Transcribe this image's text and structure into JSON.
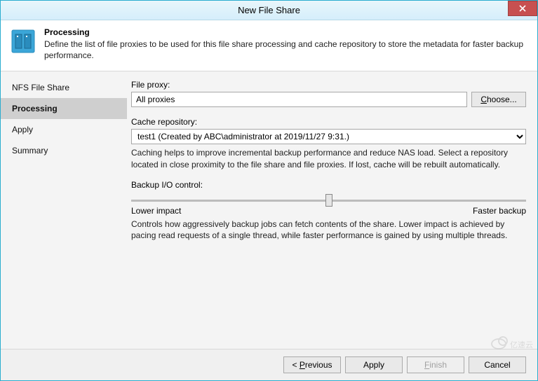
{
  "titlebar": {
    "title": "New File Share"
  },
  "header": {
    "title": "Processing",
    "description": "Define the list of file proxies to be used for this file share processing and cache repository to store the metadata for faster backup performance."
  },
  "sidebar": {
    "items": [
      {
        "label": "NFS File Share"
      },
      {
        "label": "Processing"
      },
      {
        "label": "Apply"
      },
      {
        "label": "Summary"
      }
    ]
  },
  "content": {
    "file_proxy_label": "File proxy:",
    "file_proxy_value": "All proxies",
    "choose_label": "Choose...",
    "cache_repo_label": "Cache repository:",
    "cache_repo_value": "test1 (Created by ABC\\administrator at 2019/11/27 9:31.)",
    "cache_help": "Caching helps to improve incremental backup performance and reduce NAS load. Select a repository located in close proximity to the file share and file proxies. If lost, cache will be rebuilt automatically.",
    "backup_io_label": "Backup I/O control:",
    "slider_low": "Lower impact",
    "slider_high": "Faster backup",
    "io_help": "Controls how aggressively backup jobs can fetch contents of the share. Lower impact is achieved by pacing read requests of a single thread, while faster performance is gained by using multiple threads."
  },
  "footer": {
    "previous": "Previous",
    "apply": "Apply",
    "finish": "Finish",
    "cancel": "Cancel"
  },
  "watermark": "亿速云"
}
